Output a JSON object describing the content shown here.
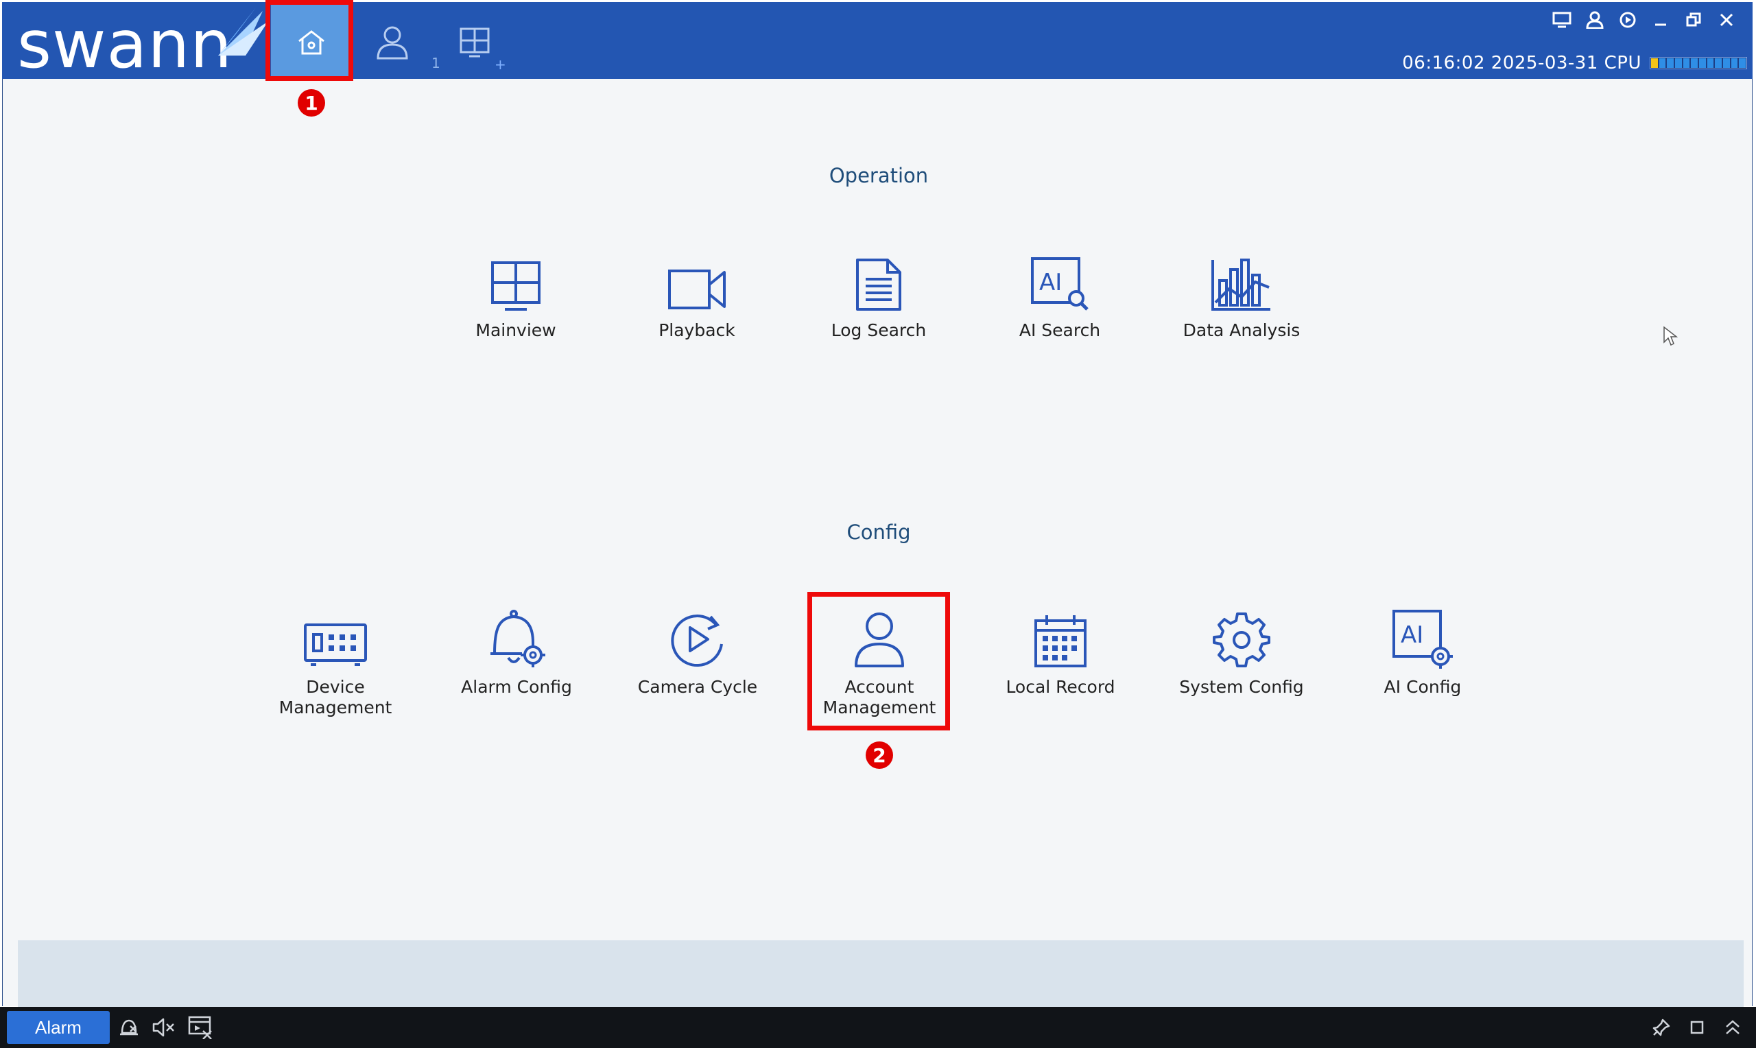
{
  "app": {
    "logo_text": "swann"
  },
  "header": {
    "tabs": [
      {
        "name": "home",
        "sub": ""
      },
      {
        "name": "account",
        "sub": "1"
      },
      {
        "name": "layout",
        "sub": "+"
      }
    ],
    "clock": "06:16:02 2025-03-31 CPU",
    "cpu_segments": 12
  },
  "sections": {
    "operation": {
      "title": "Operation",
      "items": [
        {
          "label": "Mainview",
          "icon": "mainview-icon"
        },
        {
          "label": "Playback",
          "icon": "playback-icon"
        },
        {
          "label": "Log Search",
          "icon": "log-search-icon"
        },
        {
          "label": "AI Search",
          "icon": "ai-search-icon"
        },
        {
          "label": "Data Analysis",
          "icon": "data-analysis-icon"
        }
      ]
    },
    "config": {
      "title": "Config",
      "items": [
        {
          "label": "Device\nManagement",
          "icon": "device-management-icon"
        },
        {
          "label": "Alarm Config",
          "icon": "alarm-config-icon"
        },
        {
          "label": "Camera Cycle",
          "icon": "camera-cycle-icon"
        },
        {
          "label": "Account\nManagement",
          "icon": "account-management-icon"
        },
        {
          "label": "Local Record",
          "icon": "local-record-icon"
        },
        {
          "label": "System Config",
          "icon": "system-config-icon"
        },
        {
          "label": "AI Config",
          "icon": "ai-config-icon"
        }
      ]
    }
  },
  "annotations": [
    {
      "number": "1"
    },
    {
      "number": "2"
    }
  ],
  "taskbar": {
    "alarm_label": "Alarm"
  },
  "colors": {
    "header": "#2356b2",
    "active_tab": "#5a9ae0",
    "icon": "#2a56b8",
    "highlight": "#ee0a0a",
    "background": "#f4f6f8"
  }
}
